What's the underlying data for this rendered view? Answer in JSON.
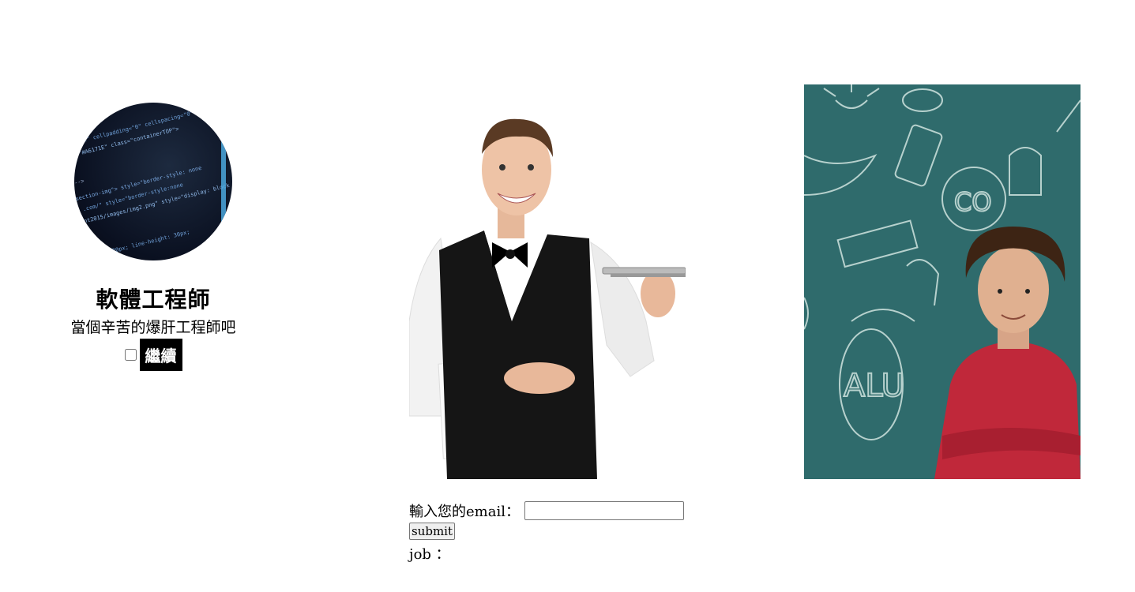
{
  "card": {
    "title": "軟體工程師",
    "subtitle": "當個辛苦的爆肝工程師吧",
    "continue_label": "繼續"
  },
  "form": {
    "email_label": "輸入您的email：",
    "email_value": "",
    "submit_label": "submit",
    "job_label": "job ："
  },
  "images": {
    "avatar_icon": "code-screen-image",
    "waiter_icon": "waiter-image",
    "boy_icon": "boy-chalkboard-image"
  },
  "colors": {
    "chalkboard": "#2f6b6c",
    "sweater": "#c0283a"
  }
}
